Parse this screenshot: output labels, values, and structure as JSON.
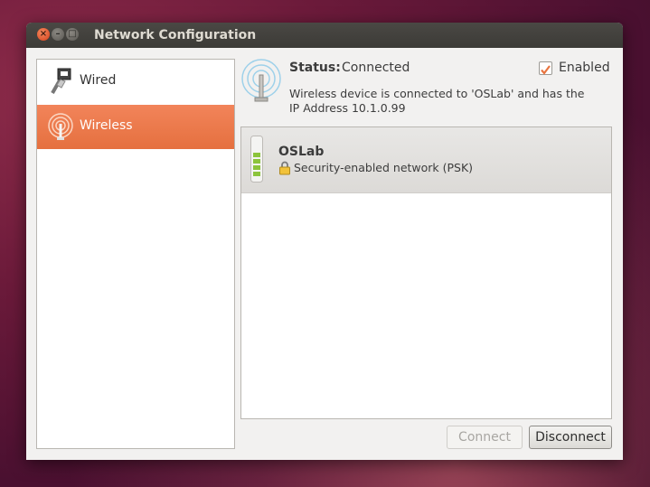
{
  "window": {
    "title": "Network Configuration",
    "controls": {
      "close": "×",
      "minimize": "–",
      "maximize": "□"
    }
  },
  "sidebar": {
    "items": [
      {
        "label": "Wired",
        "icon": "wired-plug-icon",
        "selected": false
      },
      {
        "label": "Wireless",
        "icon": "wireless-antenna-icon",
        "selected": true
      }
    ]
  },
  "status": {
    "label": "Status:",
    "value": "Connected",
    "description": "Wireless device is connected to 'OSLab' and has the IP Address 10.1.0.99",
    "icon": "wireless-antenna-icon"
  },
  "enabled": {
    "label": "Enabled",
    "checked": true
  },
  "networks": [
    {
      "name": "OSLab",
      "security": "Security-enabled network (PSK)",
      "signal_strength": 1.0,
      "icons": [
        "signal-strength-icon",
        "lock-icon"
      ]
    }
  ],
  "buttons": {
    "connect": "Connect",
    "disconnect": "Disconnect"
  },
  "colors": {
    "accent": "#e9743f",
    "titlebar": "#3c3b37",
    "window": "#f2f1f0"
  }
}
